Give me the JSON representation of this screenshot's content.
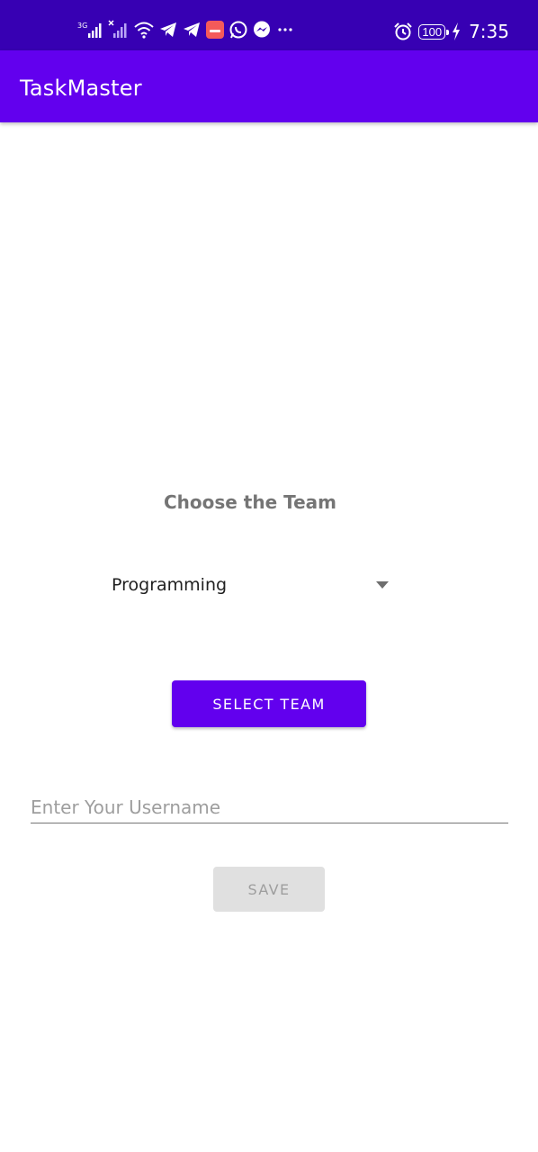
{
  "status_bar": {
    "network_label": "3G",
    "battery_level": "100",
    "time": "7:35",
    "icons": [
      "signal-icon",
      "signal-no-service-icon",
      "wifi-icon",
      "telegram-icon",
      "telegram-icon",
      "app-notification-icon",
      "whatsapp-icon",
      "messenger-icon",
      "more-icon",
      "alarm-icon",
      "battery-icon",
      "charging-icon"
    ],
    "colors": {
      "background": "#3700b3"
    }
  },
  "app_bar": {
    "title": "TaskMaster",
    "colors": {
      "background": "#6200ee"
    }
  },
  "main": {
    "choose_label": "Choose the Team",
    "team_spinner": {
      "selected": "Programming"
    },
    "select_team_button": "SELECT TEAM",
    "username_input": {
      "placeholder": "Enter Your Username",
      "value": ""
    },
    "save_button": {
      "label": "SAVE",
      "enabled": false
    }
  },
  "colors": {
    "primary": "#6200ee",
    "primary_dark": "#3700b3",
    "disabled_button": "#e0e0e0"
  }
}
